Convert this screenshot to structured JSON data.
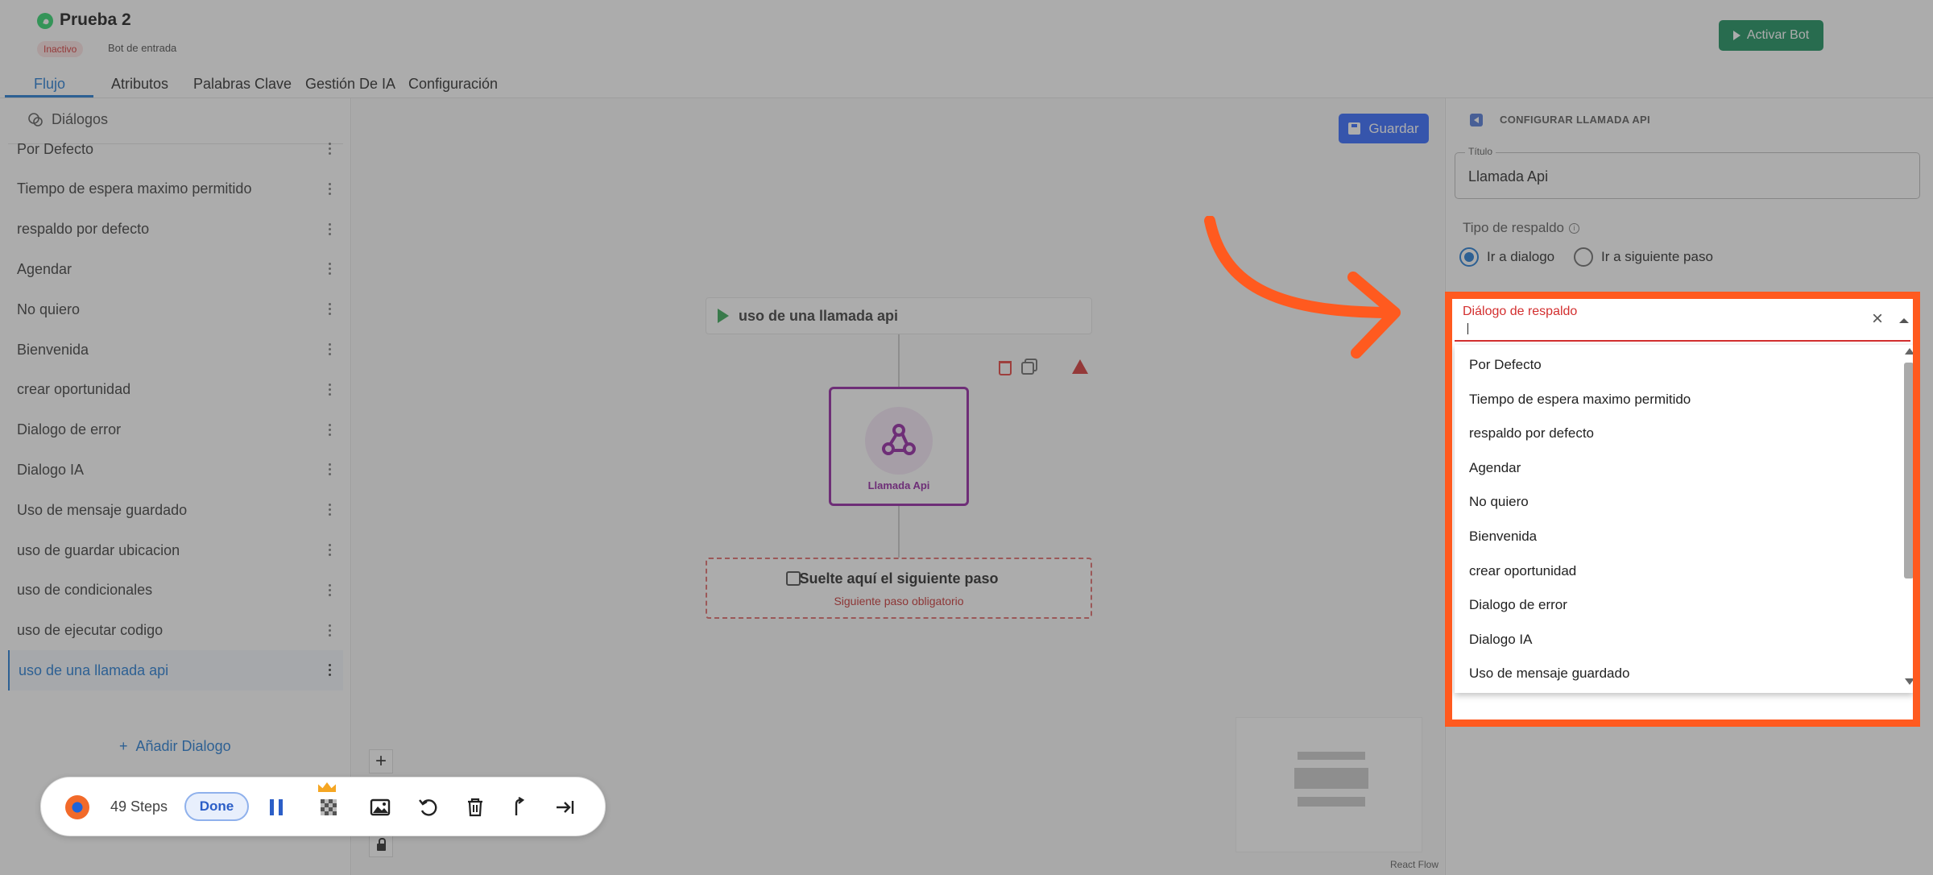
{
  "header": {
    "bot_name": "Prueba 2",
    "status": "Inactivo",
    "bot_type": "Bot de entrada",
    "activate_label": "Activar Bot"
  },
  "tabs": [
    {
      "label": "Flujo",
      "active": true
    },
    {
      "label": "Atributos"
    },
    {
      "label": "Palabras Clave"
    },
    {
      "label": "Gestión De IA"
    },
    {
      "label": "Configuración"
    }
  ],
  "sidebar": {
    "heading": "Diálogos",
    "items": [
      "Por Defecto",
      "Tiempo de espera maximo permitido",
      "respaldo por defecto",
      "Agendar",
      "No quiero",
      "Bienvenida",
      "crear oportunidad",
      "Dialogo de error",
      "Dialogo IA",
      "Uso de mensaje guardado",
      "uso de guardar ubicacion",
      "uso de condicionales",
      "uso de ejecutar codigo",
      "uso de una llamada api"
    ],
    "active_index": 13,
    "add_label": "Añadir Dialogo"
  },
  "canvas": {
    "save_label": "Guardar",
    "start_node_label": "uso de una llamada api",
    "api_node_label": "Llamada Api",
    "drop_title": "Suelte aquí el siguiente paso",
    "drop_sub": "Siguiente paso obligatorio",
    "zoom_in": "+",
    "attribution": "React Flow"
  },
  "recorder": {
    "steps": "49 Steps",
    "done_label": "Done"
  },
  "panel": {
    "title": "CONFIGURAR LLAMADA API",
    "title_field_label": "Título",
    "title_field_value": "Llamada Api",
    "fallback_label": "Tipo de respaldo",
    "radio_options": [
      "Ir a dialogo",
      "Ir a siguiente paso"
    ],
    "radio_selected": 0,
    "select_label": "Diálogo de respaldo",
    "select_options": [
      "Por Defecto",
      "Tiempo de espera maximo permitido",
      "respaldo por defecto",
      "Agendar",
      "No quiero",
      "Bienvenida",
      "crear oportunidad",
      "Dialogo de error",
      "Dialogo IA",
      "Uso de mensaje guardado"
    ]
  },
  "colors": {
    "accent": "#1976d2",
    "activate": "#0f8a57",
    "api_node": "#8e1b9f",
    "highlight": "#ff5a1f",
    "error": "#d32f2f"
  }
}
